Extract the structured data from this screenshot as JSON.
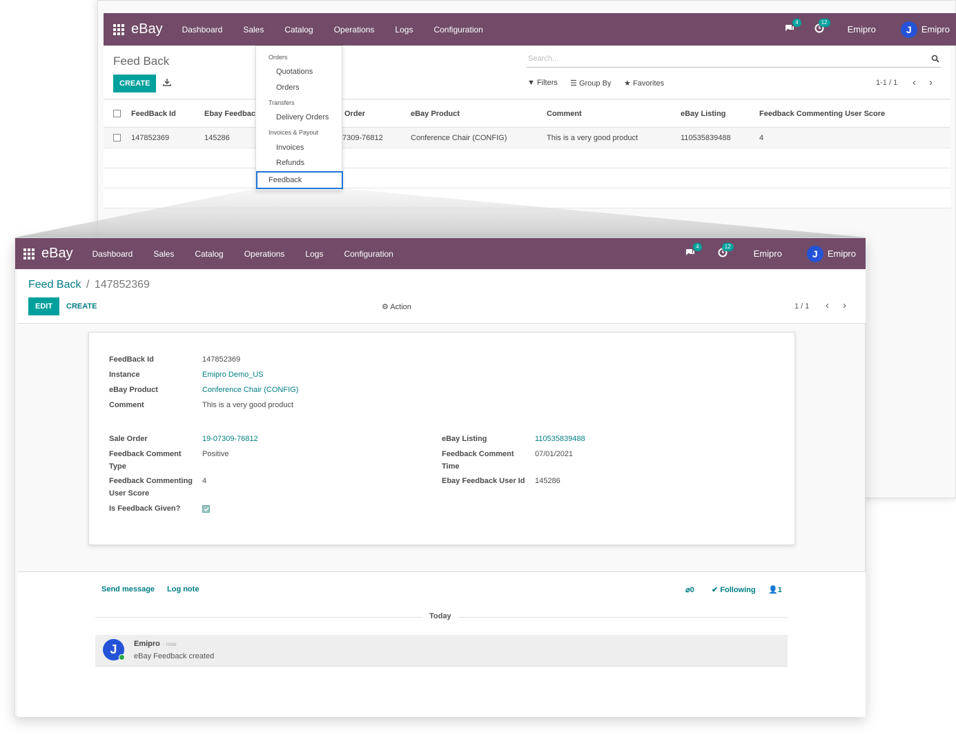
{
  "bg": {
    "app_name": "eBay",
    "menu": [
      "Dashboard",
      "Sales",
      "Catalog",
      "Operations",
      "Logs",
      "Configuration"
    ],
    "messages_count": "4",
    "activities_count": "12",
    "company": "Emipro",
    "user": "Emipro",
    "title": "Feed Back",
    "create_label": "CREATE",
    "search_placeholder": "Search...",
    "filters_label": "Filters",
    "groupby_label": "Group By",
    "favorites_label": "Favorites",
    "pager": "1-1 / 1",
    "columns": [
      "FeedBack Id",
      "Ebay Feedback",
      "Order",
      "eBay Product",
      "Comment",
      "eBay Listing",
      "Feedback Commenting User Score"
    ],
    "row": [
      "147852369",
      "145286",
      "7309-76812",
      "Conference Chair (CONFIG)",
      "This is a very good product",
      "110535839488",
      "4"
    ],
    "dropdown": {
      "section_orders": "Orders",
      "quotations": "Quotations",
      "orders": "Orders",
      "section_transfers": "Transfers",
      "delivery_orders": "Delivery Orders",
      "section_invoices": "Invoices & Payout",
      "invoices": "Invoices",
      "refunds": "Refunds",
      "feedback": "Feedback"
    }
  },
  "fg": {
    "app_name": "eBay",
    "menu": [
      "Dashboard",
      "Sales",
      "Catalog",
      "Operations",
      "Logs",
      "Configuration"
    ],
    "messages_count": "4",
    "activities_count": "12",
    "company": "Emipro",
    "user": "Emipro",
    "breadcrumb_parent": "Feed Back",
    "breadcrumb_sep": "/",
    "breadcrumb_current": "147852369",
    "edit_label": "EDIT",
    "create_label": "CREATE",
    "action_label": "Action",
    "pager": "1 / 1",
    "form": {
      "feedback_id_label": "FeedBack Id",
      "feedback_id": "147852369",
      "instance_label": "Instance",
      "instance": "Emipro Demo_US",
      "product_label": "eBay Product",
      "product": "Conference Chair (CONFIG)",
      "comment_label": "Comment",
      "comment": "This is a very good product",
      "sale_order_label": "Sale Order",
      "sale_order": "19-07309-76812",
      "fb_comment_type_label1": "Feedback Comment",
      "fb_comment_type_label2": "Type",
      "fb_comment_type": "Positive",
      "user_score_label1": "Feedback Commenting",
      "user_score_label2": "User Score",
      "user_score": "4",
      "is_given_label": "Is Feedback Given?",
      "listing_label": "eBay Listing",
      "listing": "110535839488",
      "fb_time_label1": "Feedback Comment",
      "fb_time_label2": "Time",
      "fb_time": "07/01/2021",
      "fb_user_id_label": "Ebay Feedback User Id",
      "fb_user_id": "145286"
    },
    "chatter": {
      "send_message": "Send message",
      "log_note": "Log note",
      "attachments": "0",
      "following": "Following",
      "followers": "1",
      "today": "Today",
      "author": "Emipro",
      "time": "- now",
      "body": "eBay Feedback created"
    }
  }
}
